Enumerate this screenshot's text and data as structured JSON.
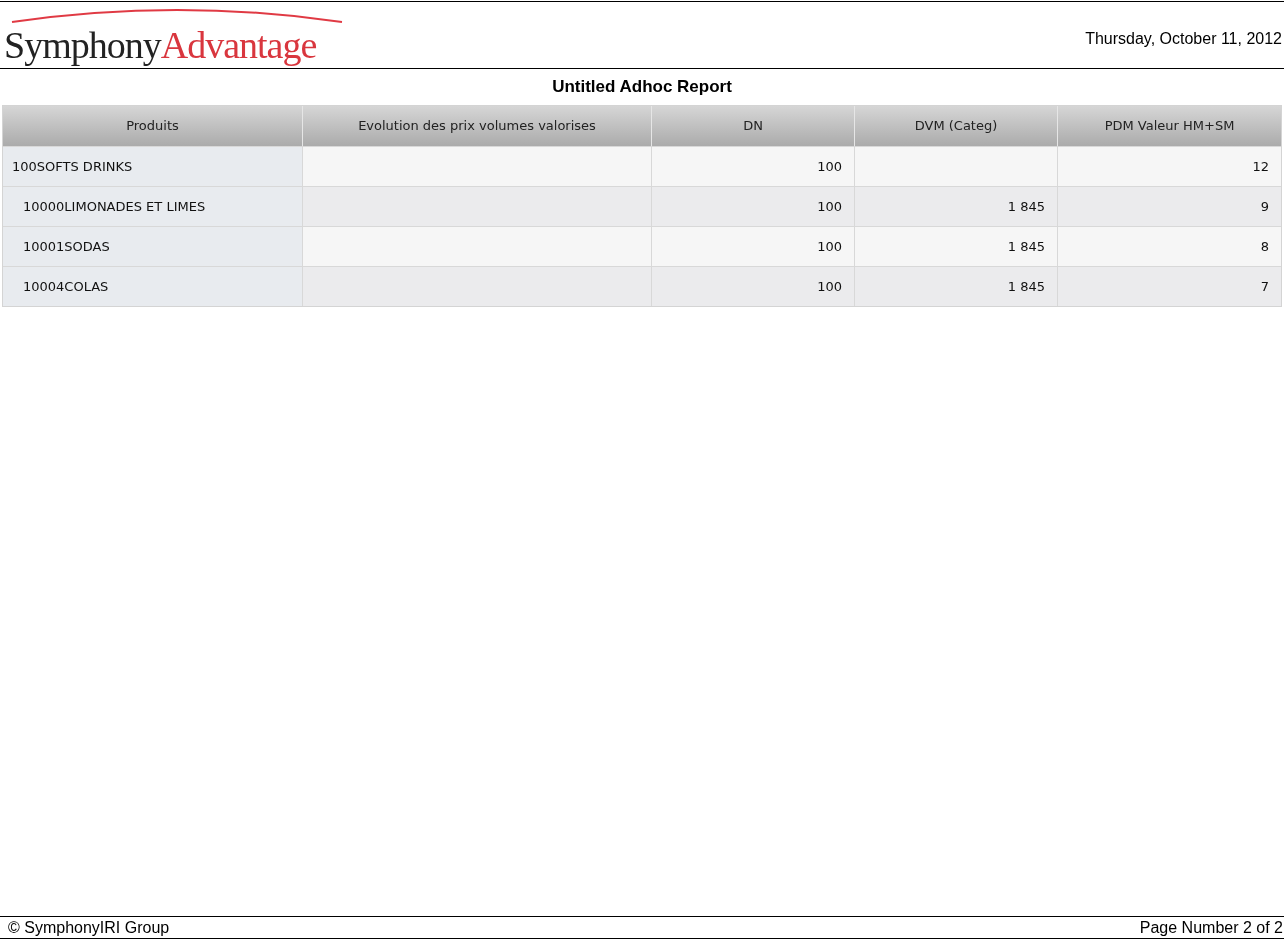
{
  "header": {
    "logo": {
      "part_1": "Symphony",
      "part_2": "Advantage"
    },
    "date": "Thursday, October 11, 2012"
  },
  "report_title": "Untitled Adhoc Report",
  "table": {
    "columns": [
      "Produits",
      "Evolution des prix volumes valorises",
      "DN",
      "DVM (Categ)",
      "PDM Valeur HM+SM"
    ],
    "rows": [
      {
        "label": "100SOFTS DRINKS",
        "cells": [
          null,
          "100",
          null,
          "12"
        ],
        "children": [
          {
            "label": "10000LIMONADES ET LIMES",
            "cells": [
              null,
              "100",
              "1 845",
              "9"
            ]
          },
          {
            "label": "10001SODAS",
            "cells": [
              null,
              "100",
              "1 845",
              "8"
            ]
          },
          {
            "label": "10004COLAS",
            "cells": [
              null,
              "100",
              "1 845",
              "7"
            ]
          }
        ]
      }
    ]
  },
  "footer": {
    "copyright": "© SymphonyIRI Group",
    "page_number": "Page Number 2 of 2"
  }
}
